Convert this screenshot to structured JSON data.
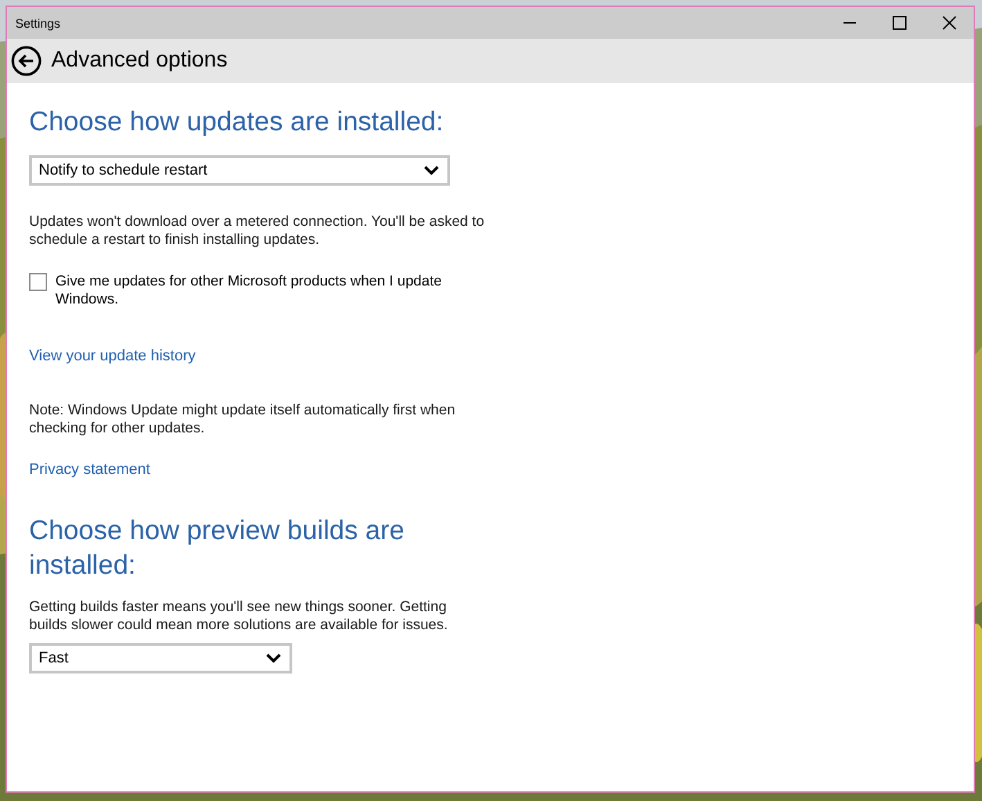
{
  "window": {
    "title": "Settings"
  },
  "header": {
    "title": "Advanced options"
  },
  "content": [
    {
      "kind": "heading",
      "text": "Choose how updates are installed:"
    },
    {
      "kind": "dropdown",
      "value": "Notify to schedule restart"
    },
    {
      "kind": "text",
      "text": "Updates won't download over a metered connection. You'll be asked to schedule a restart to finish installing updates."
    },
    {
      "kind": "checkbox",
      "label": "Give me updates for other Microsoft products when I update Windows.",
      "checked": false
    },
    {
      "kind": "link",
      "text": "View your update history"
    },
    {
      "kind": "text",
      "text": "Note: Windows Update might update itself automatically first when checking for other updates."
    },
    {
      "kind": "link",
      "text": "Privacy statement"
    },
    {
      "kind": "heading",
      "text": "Choose how preview builds are installed:"
    },
    {
      "kind": "text",
      "text": "Getting builds faster means you'll see new things sooner. Getting builds slower could mean more solutions are available for issues."
    },
    {
      "kind": "dropdown",
      "value": "Fast"
    }
  ]
}
